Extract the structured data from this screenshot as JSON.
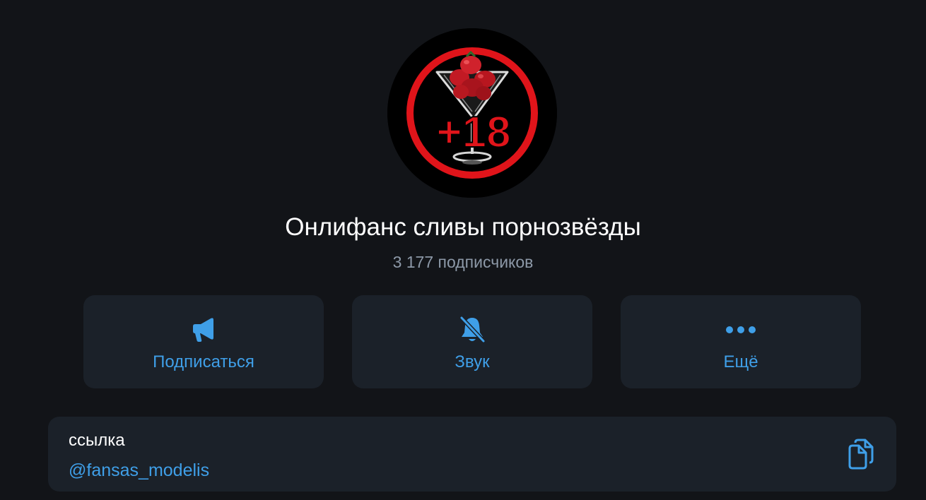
{
  "channel": {
    "name": "Онлифанс сливы порнозвёзды",
    "subscribers": "3 177 подписчиков",
    "avatar": {
      "badge_text": "+18",
      "icon": "adult-18-cocktail-strawberries-logo"
    }
  },
  "actions": [
    {
      "label": "Подписаться",
      "icon": "megaphone-icon"
    },
    {
      "label": "Звук",
      "icon": "bell-muted-icon"
    },
    {
      "label": "Ещё",
      "icon": "more-dots-icon"
    }
  ],
  "info": {
    "link_label": "ссылка",
    "link_value": "@fansas_modelis",
    "copy_icon": "copy-icon"
  },
  "colors": {
    "background": "#121418",
    "card": "#1b2129",
    "accent": "#3f9fe8",
    "title": "#ffffff",
    "muted": "#8d99a8",
    "logo_red": "#e0141a"
  }
}
